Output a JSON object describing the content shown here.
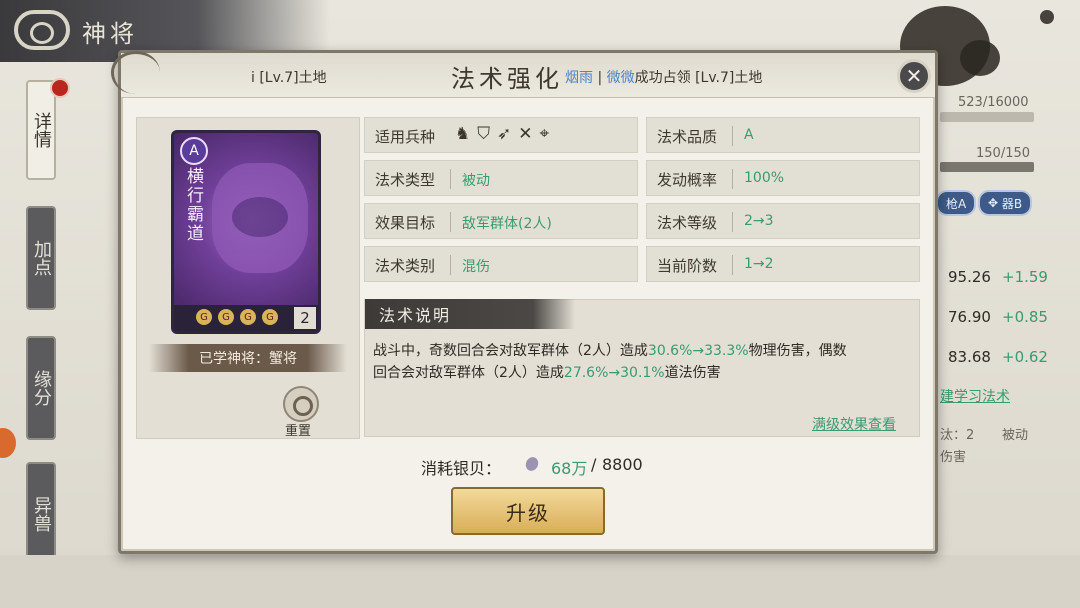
{
  "header": {
    "title": "神将"
  },
  "side_tabs": [
    {
      "label": "详情",
      "active": true
    },
    {
      "label": "加点",
      "active": false
    },
    {
      "label": "缘分",
      "active": false
    },
    {
      "label": "异兽",
      "active": false
    }
  ],
  "bg_panel": {
    "exp": "523/16000",
    "hp": "150/150",
    "badge_a": "枪A",
    "badge_b": "器B",
    "stats": [
      {
        "value": "95.26",
        "delta": "+1.59"
      },
      {
        "value": "76.90",
        "delta": "+0.85"
      },
      {
        "value": "83.68",
        "delta": "+0.62"
      }
    ],
    "learn_link": "建学习法术",
    "skill_level": "汰：2",
    "skill_type": "被动",
    "skill_desc": "伤害"
  },
  "modal": {
    "title": "法术强化",
    "head_left": "i [Lv.7]土地",
    "head_msg": {
      "name1": "烟雨",
      "sep": " | ",
      "name2": "微微",
      "text": "成功占领 [Lv.7]土地"
    },
    "close_icon": "✕",
    "card": {
      "grade": "A",
      "name": "横行霸道",
      "slots": [
        "G",
        "G",
        "G",
        "G"
      ],
      "level": "2"
    },
    "learned_by": "已学神将：蟹将",
    "reset_label": "重置",
    "attrs": [
      {
        "key": "适用兵种",
        "value": ""
      },
      {
        "key": "法术品质",
        "value": "A"
      },
      {
        "key": "法术类型",
        "value": "被动"
      },
      {
        "key": "发动概率",
        "value": "100%"
      },
      {
        "key": "效果目标",
        "value": "敌军群体(2人)"
      },
      {
        "key": "法术等级",
        "value": "2→3"
      },
      {
        "key": "法术类别",
        "value": "混伤"
      },
      {
        "key": "当前阶数",
        "value": "1→2"
      }
    ],
    "troop_icons": [
      "horse-icon",
      "shield-icon",
      "bow-icon",
      "spear-icon",
      "target-icon"
    ],
    "desc": {
      "title": "法术说明",
      "line1_a": "战斗中，奇数回合会对敌军群体（2人）造成",
      "line1_hl": "30.6%→33.3%",
      "line1_b": "物理伤害，偶数",
      "line2_a": "回合会对敌军群体（2人）造成",
      "line2_hl": "27.6%→30.1%",
      "line2_b": "道法伤害"
    },
    "max_link": "满级效果查看",
    "cost": {
      "label": "消耗银贝：",
      "have": "68万",
      "sep": "/",
      "need": "8800"
    },
    "upgrade": "升级"
  }
}
